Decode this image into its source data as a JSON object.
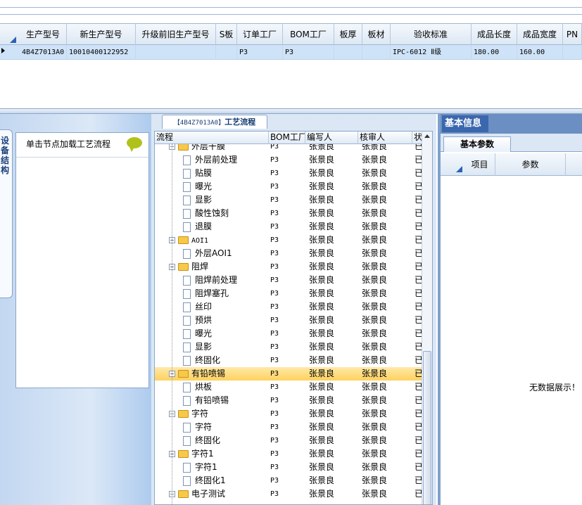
{
  "grid": {
    "columns": [
      "生产型号",
      "新生产型号",
      "升级前旧生产型号",
      "S板",
      "订单工厂",
      "BOM工厂",
      "板厚",
      "板材",
      "验收标准",
      "成品长度",
      "成品宽度",
      "PN"
    ],
    "row": [
      "4B4Z7013A0",
      "10010400122952",
      "",
      "",
      "P3",
      "P3",
      "",
      "",
      "IPC-6012 Ⅱ级",
      "180.00",
      "160.00",
      ""
    ]
  },
  "left": {
    "tab_label": "设备结构",
    "hint": "单击节点加载工艺流程"
  },
  "middle": {
    "title_code": "【4B4Z7013A0】",
    "title_text": "工艺流程",
    "columns": [
      "流程",
      "BOM工厂",
      "编写人",
      "核审人",
      "状"
    ],
    "rows": [
      {
        "name": "外层干膜",
        "type": "folder",
        "bom": "P3",
        "writer": "张景良",
        "reviewer": "张景良",
        "status": "已"
      },
      {
        "name": "外层前处理",
        "type": "doc",
        "bom": "P3",
        "writer": "张景良",
        "reviewer": "张景良",
        "status": "已"
      },
      {
        "name": "贴膜",
        "type": "doc",
        "bom": "P3",
        "writer": "张景良",
        "reviewer": "张景良",
        "status": "已"
      },
      {
        "name": "曝光",
        "type": "doc",
        "bom": "P3",
        "writer": "张景良",
        "reviewer": "张景良",
        "status": "已"
      },
      {
        "name": "显影",
        "type": "doc",
        "bom": "P3",
        "writer": "张景良",
        "reviewer": "张景良",
        "status": "已"
      },
      {
        "name": "酸性蚀刻",
        "type": "doc",
        "bom": "P3",
        "writer": "张景良",
        "reviewer": "张景良",
        "status": "已"
      },
      {
        "name": "退膜",
        "type": "doc",
        "bom": "P3",
        "writer": "张景良",
        "reviewer": "张景良",
        "status": "已"
      },
      {
        "name": "AOI1",
        "type": "folder",
        "bom": "P3",
        "writer": "张景良",
        "reviewer": "张景良",
        "status": "已"
      },
      {
        "name": "外层AOI1",
        "type": "doc",
        "bom": "P3",
        "writer": "张景良",
        "reviewer": "张景良",
        "status": "已"
      },
      {
        "name": "阻焊",
        "type": "folder",
        "bom": "P3",
        "writer": "张景良",
        "reviewer": "张景良",
        "status": "已"
      },
      {
        "name": "阻焊前处理",
        "type": "doc",
        "bom": "P3",
        "writer": "张景良",
        "reviewer": "张景良",
        "status": "已"
      },
      {
        "name": "阻焊塞孔",
        "type": "doc",
        "bom": "P3",
        "writer": "张景良",
        "reviewer": "张景良",
        "status": "已"
      },
      {
        "name": "丝印",
        "type": "doc",
        "bom": "P3",
        "writer": "张景良",
        "reviewer": "张景良",
        "status": "已"
      },
      {
        "name": "预烘",
        "type": "doc",
        "bom": "P3",
        "writer": "张景良",
        "reviewer": "张景良",
        "status": "已"
      },
      {
        "name": "曝光",
        "type": "doc",
        "bom": "P3",
        "writer": "张景良",
        "reviewer": "张景良",
        "status": "已"
      },
      {
        "name": "显影",
        "type": "doc",
        "bom": "P3",
        "writer": "张景良",
        "reviewer": "张景良",
        "status": "已"
      },
      {
        "name": "终固化",
        "type": "doc",
        "bom": "P3",
        "writer": "张景良",
        "reviewer": "张景良",
        "status": "已"
      },
      {
        "name": "有铅喷锡",
        "type": "folder",
        "bom": "P3",
        "writer": "张景良",
        "reviewer": "张景良",
        "status": "已",
        "selected": true
      },
      {
        "name": "烘板",
        "type": "doc",
        "bom": "P3",
        "writer": "张景良",
        "reviewer": "张景良",
        "status": "已"
      },
      {
        "name": "有铅喷锡",
        "type": "doc",
        "bom": "P3",
        "writer": "张景良",
        "reviewer": "张景良",
        "status": "已"
      },
      {
        "name": "字符",
        "type": "folder",
        "bom": "P3",
        "writer": "张景良",
        "reviewer": "张景良",
        "status": "已"
      },
      {
        "name": "字符",
        "type": "doc",
        "bom": "P3",
        "writer": "张景良",
        "reviewer": "张景良",
        "status": "已"
      },
      {
        "name": "终固化",
        "type": "doc",
        "bom": "P3",
        "writer": "张景良",
        "reviewer": "张景良",
        "status": "已"
      },
      {
        "name": "字符1",
        "type": "folder",
        "bom": "P3",
        "writer": "张景良",
        "reviewer": "张景良",
        "status": "已"
      },
      {
        "name": "字符1",
        "type": "doc",
        "bom": "P3",
        "writer": "张景良",
        "reviewer": "张景良",
        "status": "已"
      },
      {
        "name": "终固化1",
        "type": "doc",
        "bom": "P3",
        "writer": "张景良",
        "reviewer": "张景良",
        "status": "已"
      },
      {
        "name": "电子测试",
        "type": "folder",
        "bom": "P3",
        "writer": "张景良",
        "reviewer": "张景良",
        "status": "已"
      }
    ]
  },
  "right": {
    "tab": "基本信息",
    "subtab": "基本参数",
    "columns": [
      "项目",
      "参数"
    ],
    "empty_text": "无数据展示！"
  }
}
